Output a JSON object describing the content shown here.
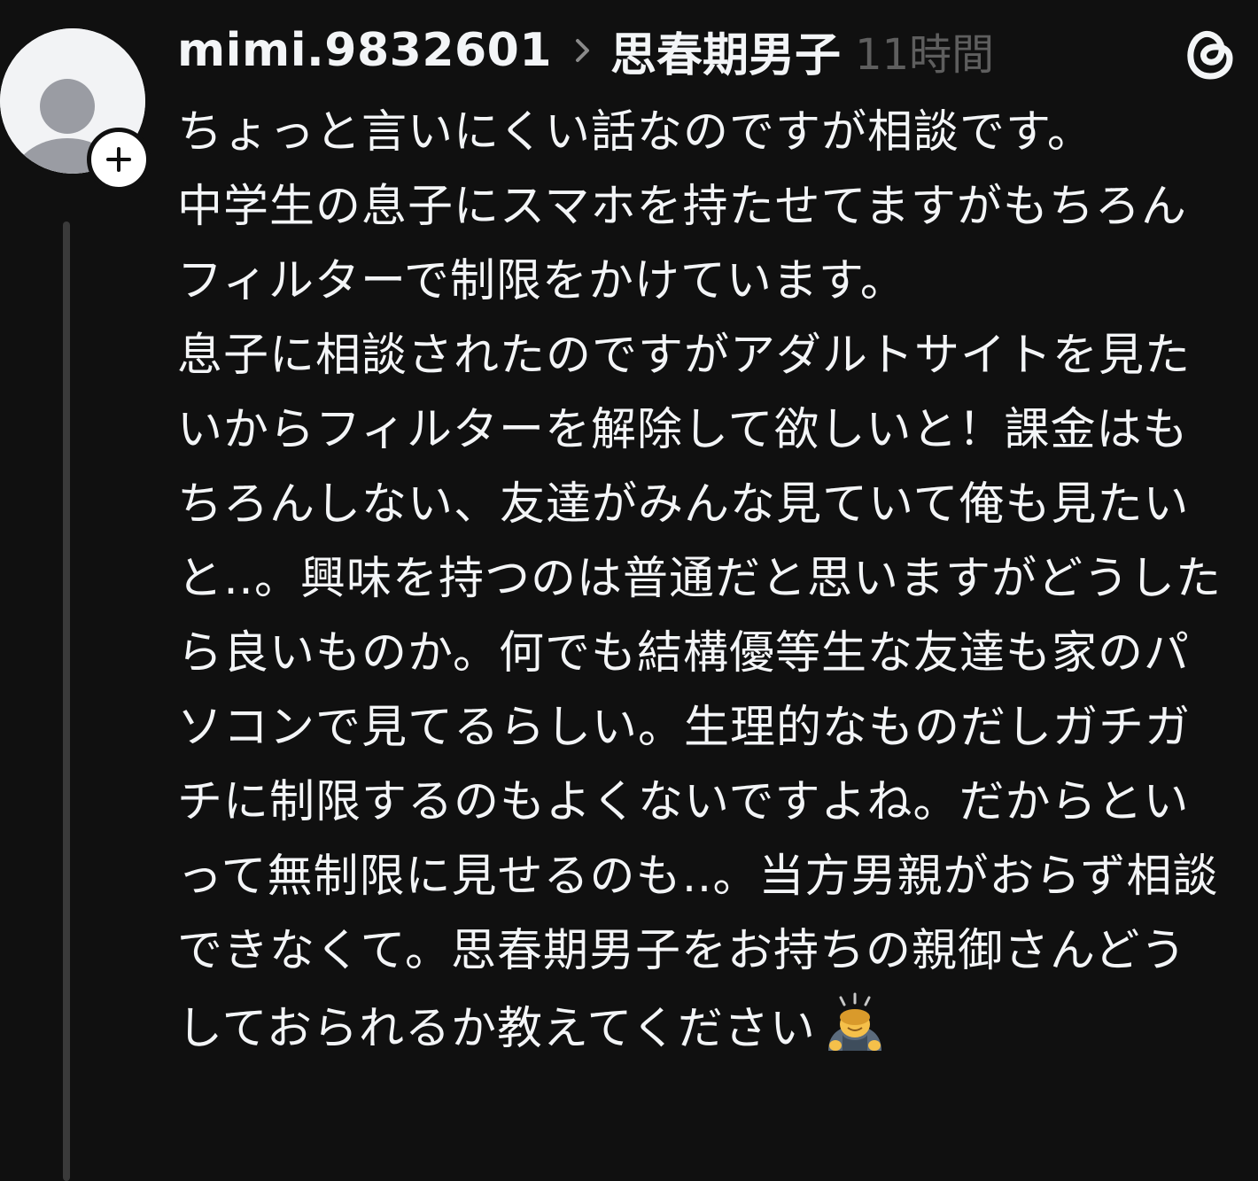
{
  "author": {
    "username": "mimi.9832601",
    "topic": "思春期男子",
    "timestamp": "11時間"
  },
  "post": {
    "paragraphs": [
      "ちょっと言いにくい話なのですが相談です。",
      "中学生の息子にスマホを持たせてますがもちろんフィルターで制限をかけています。",
      "息子に相談されたのですがアダルトサイトを見たいからフィルターを解除して欲しいと！課金はもちろんしない、友達がみんな見ていて俺も見たいと‥。興味を持つのは普通だと思いますがどうしたら良いものか。何でも結構優等生な友達も家のパソコンで見てるらしい。生理的なものだしガチガチに制限するのもよくないですよね。だからといって無制限に見せるのも‥。当方男親がおらず相談できなくて。思春期男子をお持ちの親御さんどうしておられるか教えてください"
    ],
    "trailing_emoji": "bowing-person-emoji"
  },
  "icons": {
    "avatar": "default-avatar-icon",
    "follow": "plus-icon",
    "separator": "chevron-right-icon",
    "app": "threads-logo-icon"
  },
  "colors": {
    "background": "#101010",
    "text": "#f3f5f7",
    "muted": "#5e5e5e",
    "thread_line": "#3a3a3a"
  }
}
